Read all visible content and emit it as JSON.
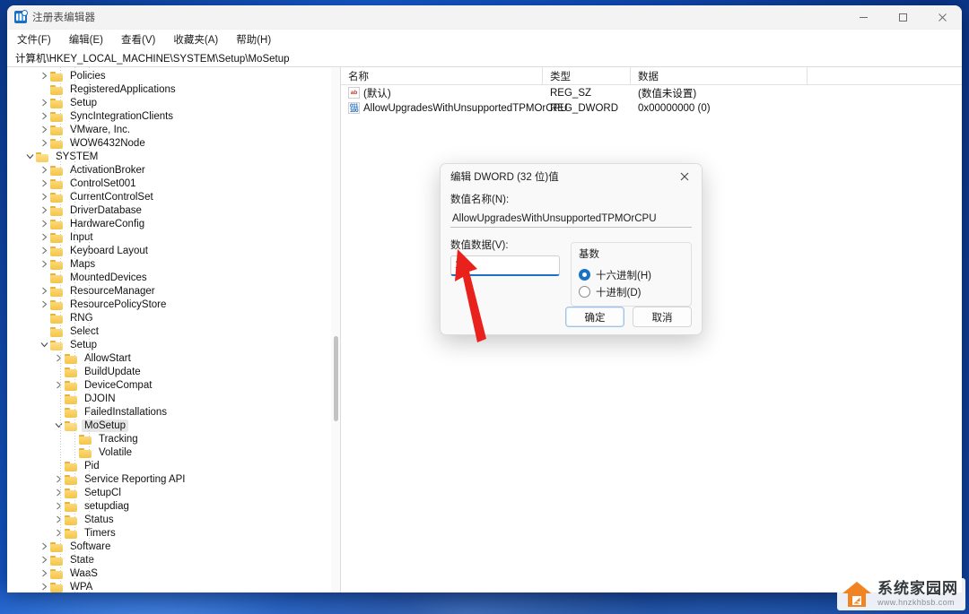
{
  "window": {
    "title": "注册表编辑器",
    "app_icon": "registry-editor-icon",
    "controls": {
      "minimize": "minimize-icon",
      "maximize": "maximize-icon",
      "close": "close-icon"
    }
  },
  "menubar": [
    {
      "label": "文件(F)",
      "name": "menu-file"
    },
    {
      "label": "编辑(E)",
      "name": "menu-edit"
    },
    {
      "label": "查看(V)",
      "name": "menu-view"
    },
    {
      "label": "收藏夹(A)",
      "name": "menu-favorites"
    },
    {
      "label": "帮助(H)",
      "name": "menu-help"
    }
  ],
  "address": "计算机\\HKEY_LOCAL_MACHINE\\SYSTEM\\Setup\\MoSetup",
  "tree": [
    {
      "label": "Policies",
      "depth": 2,
      "chevron": "right",
      "selected": false
    },
    {
      "label": "RegisteredApplications",
      "depth": 2,
      "chevron": "none",
      "selected": false
    },
    {
      "label": "Setup",
      "depth": 2,
      "chevron": "right",
      "selected": false
    },
    {
      "label": "SyncIntegrationClients",
      "depth": 2,
      "chevron": "right",
      "selected": false
    },
    {
      "label": "VMware, Inc.",
      "depth": 2,
      "chevron": "right",
      "selected": false
    },
    {
      "label": "WOW6432Node",
      "depth": 2,
      "chevron": "right",
      "selected": false
    },
    {
      "label": "SYSTEM",
      "depth": 1,
      "chevron": "down",
      "selected": false
    },
    {
      "label": "ActivationBroker",
      "depth": 2,
      "chevron": "right",
      "selected": false
    },
    {
      "label": "ControlSet001",
      "depth": 2,
      "chevron": "right",
      "selected": false
    },
    {
      "label": "CurrentControlSet",
      "depth": 2,
      "chevron": "right",
      "selected": false
    },
    {
      "label": "DriverDatabase",
      "depth": 2,
      "chevron": "right",
      "selected": false
    },
    {
      "label": "HardwareConfig",
      "depth": 2,
      "chevron": "right",
      "selected": false
    },
    {
      "label": "Input",
      "depth": 2,
      "chevron": "right",
      "selected": false
    },
    {
      "label": "Keyboard Layout",
      "depth": 2,
      "chevron": "right",
      "selected": false
    },
    {
      "label": "Maps",
      "depth": 2,
      "chevron": "right",
      "selected": false
    },
    {
      "label": "MountedDevices",
      "depth": 2,
      "chevron": "none",
      "selected": false
    },
    {
      "label": "ResourceManager",
      "depth": 2,
      "chevron": "right",
      "selected": false
    },
    {
      "label": "ResourcePolicyStore",
      "depth": 2,
      "chevron": "right",
      "selected": false
    },
    {
      "label": "RNG",
      "depth": 2,
      "chevron": "none",
      "selected": false
    },
    {
      "label": "Select",
      "depth": 2,
      "chevron": "none",
      "selected": false
    },
    {
      "label": "Setup",
      "depth": 2,
      "chevron": "down",
      "selected": false
    },
    {
      "label": "AllowStart",
      "depth": 3,
      "chevron": "right",
      "selected": false
    },
    {
      "label": "BuildUpdate",
      "depth": 3,
      "chevron": "none",
      "selected": false
    },
    {
      "label": "DeviceCompat",
      "depth": 3,
      "chevron": "right",
      "selected": false
    },
    {
      "label": "DJOIN",
      "depth": 3,
      "chevron": "none",
      "selected": false
    },
    {
      "label": "FailedInstallations",
      "depth": 3,
      "chevron": "none",
      "selected": false
    },
    {
      "label": "MoSetup",
      "depth": 3,
      "chevron": "down",
      "selected": true
    },
    {
      "label": "Tracking",
      "depth": 4,
      "chevron": "none",
      "selected": false
    },
    {
      "label": "Volatile",
      "depth": 4,
      "chevron": "none",
      "selected": false
    },
    {
      "label": "Pid",
      "depth": 3,
      "chevron": "none",
      "selected": false
    },
    {
      "label": "Service Reporting API",
      "depth": 3,
      "chevron": "right",
      "selected": false
    },
    {
      "label": "SetupCl",
      "depth": 3,
      "chevron": "right",
      "selected": false
    },
    {
      "label": "setupdiag",
      "depth": 3,
      "chevron": "right",
      "selected": false
    },
    {
      "label": "Status",
      "depth": 3,
      "chevron": "right",
      "selected": false
    },
    {
      "label": "Timers",
      "depth": 3,
      "chevron": "right",
      "selected": false
    },
    {
      "label": "Software",
      "depth": 2,
      "chevron": "right",
      "selected": false
    },
    {
      "label": "State",
      "depth": 2,
      "chevron": "right",
      "selected": false
    },
    {
      "label": "WaaS",
      "depth": 2,
      "chevron": "right",
      "selected": false
    },
    {
      "label": "WPA",
      "depth": 2,
      "chevron": "right",
      "selected": false
    }
  ],
  "list": {
    "headers": {
      "name": "名称",
      "type": "类型",
      "data": "数据"
    },
    "rows": [
      {
        "icon": "string-value-icon",
        "icon_kind": "sz",
        "name": "(默认)",
        "type": "REG_SZ",
        "data": "(数值未设置)"
      },
      {
        "icon": "dword-value-icon",
        "icon_kind": "dword",
        "name": "AllowUpgradesWithUnsupportedTPMOrCPU",
        "type": "REG_DWORD",
        "data": "0x00000000 (0)"
      }
    ]
  },
  "dialog": {
    "title": "编辑 DWORD (32 位)值",
    "close_icon": "close-icon",
    "name_label": "数值名称(N):",
    "name_value": "AllowUpgradesWithUnsupportedTPMOrCPU",
    "data_label": "数值数据(V):",
    "data_value": "1",
    "base_group_label": "基数",
    "radios": [
      {
        "label": "十六进制(H)",
        "selected": true,
        "name": "radio-hexadecimal"
      },
      {
        "label": "十进制(D)",
        "selected": false,
        "name": "radio-decimal"
      }
    ],
    "ok_label": "确定",
    "cancel_label": "取消"
  },
  "annotation": {
    "arrow_color": "#e8211d",
    "name": "red-pointer-arrow"
  },
  "watermark": {
    "brand": "系统家园网",
    "url": "www.hnzkhbsb.com",
    "accent": "#f08322"
  }
}
